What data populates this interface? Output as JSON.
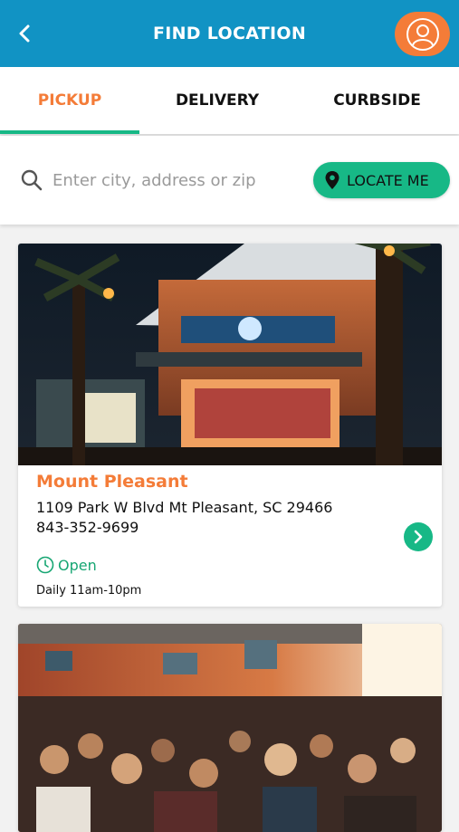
{
  "header": {
    "title": "FIND LOCATION",
    "back_icon": "chevron-left-icon",
    "profile_icon": "user-icon",
    "color": "#1193c4",
    "profile_color": "#f47c38"
  },
  "tabs": [
    {
      "label": "PICKUP",
      "active": true
    },
    {
      "label": "DELIVERY",
      "active": false
    },
    {
      "label": "CURBSIDE",
      "active": false
    }
  ],
  "search": {
    "placeholder": "Enter city, address or zip",
    "value": "",
    "locate_label": "LOCATE ME",
    "accent": "#17b886"
  },
  "locations": [
    {
      "name": "Mount Pleasant",
      "address": "1109 Park W Blvd Mt Pleasant, SC 29466",
      "phone": "843-352-9699",
      "status": "Open",
      "hours": "Daily 11am-10pm"
    }
  ]
}
